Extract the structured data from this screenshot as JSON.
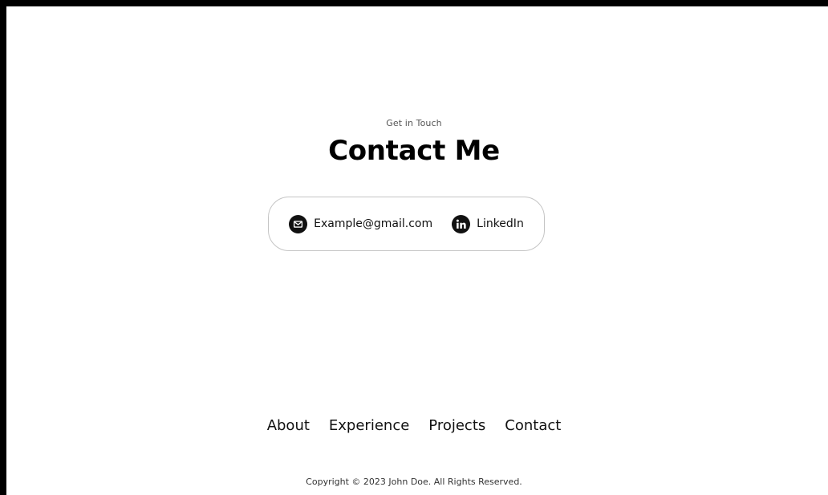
{
  "contact": {
    "subtitle": "Get in Touch",
    "title": "Contact Me",
    "email": {
      "icon": "email-icon",
      "text": "Example@gmail.com"
    },
    "linkedin": {
      "icon": "linkedin-icon",
      "text": "LinkedIn"
    }
  },
  "footer": {
    "nav": [
      "About",
      "Experience",
      "Projects",
      "Contact"
    ],
    "copyright": "Copyright © 2023 John Doe. All Rights Reserved."
  },
  "colors": {
    "frame": "#000000",
    "background": "#ffffff",
    "text": "#111111",
    "border": "#c4c4c4"
  }
}
